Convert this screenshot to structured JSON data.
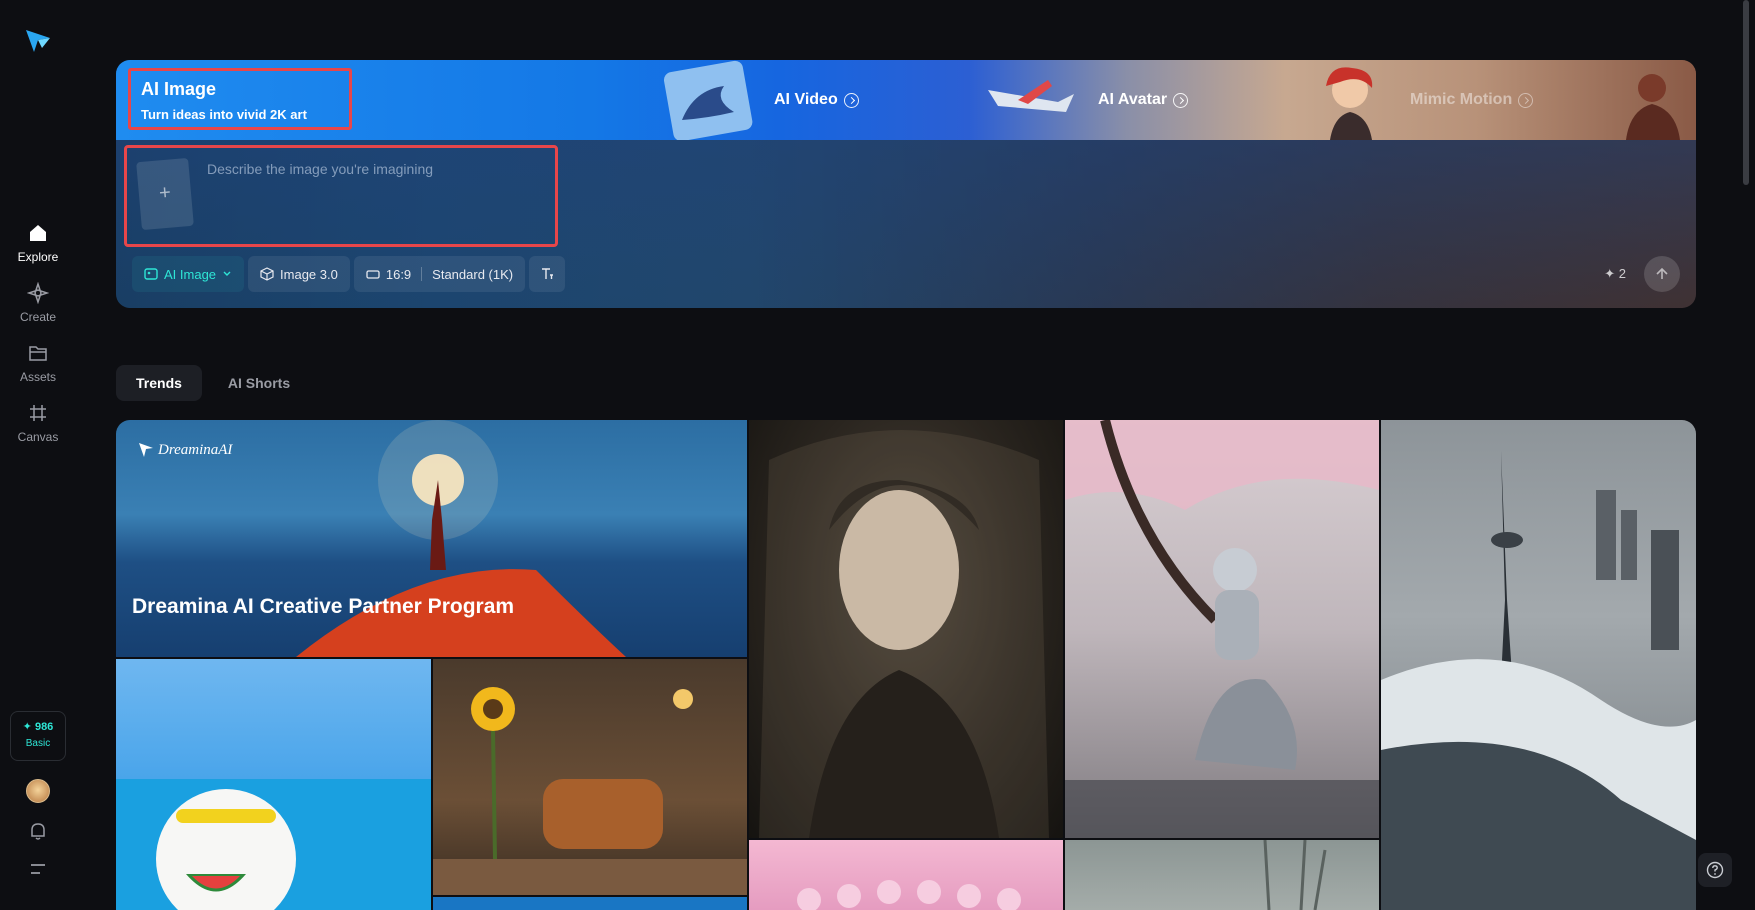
{
  "sidebar": {
    "logo": "dreamina-logo",
    "items": [
      {
        "label": "Explore",
        "icon": "home-icon"
      },
      {
        "label": "Create",
        "icon": "sparkle-icon"
      },
      {
        "label": "Assets",
        "icon": "folder-icon"
      },
      {
        "label": "Canvas",
        "icon": "canvas-icon"
      }
    ],
    "credits": {
      "value": "✦ 986",
      "plan": "Basic"
    }
  },
  "hero": {
    "title": "AI Image",
    "subtitle": "Turn ideas into vivid 2K art",
    "features": [
      {
        "label": "AI Video"
      },
      {
        "label": "AI Avatar"
      },
      {
        "label": "Mimic Motion"
      }
    ],
    "prompt": {
      "placeholder": "Describe the image you're imagining"
    },
    "upload_glyph": "+",
    "toolbar": {
      "mode": "AI Image",
      "model": "Image 3.0",
      "ratio": "16:9",
      "quality": "Standard (1K)"
    },
    "cost": "✦ 2"
  },
  "tabs": [
    "Trends",
    "AI Shorts"
  ],
  "gallery": {
    "brand": "DreaminaAI",
    "featured_caption": "Dreamina AI Creative Partner Program"
  },
  "colors": {
    "accent": "#2ee6d6",
    "highlight_border": "#e8464a",
    "background": "#0d0e12"
  }
}
